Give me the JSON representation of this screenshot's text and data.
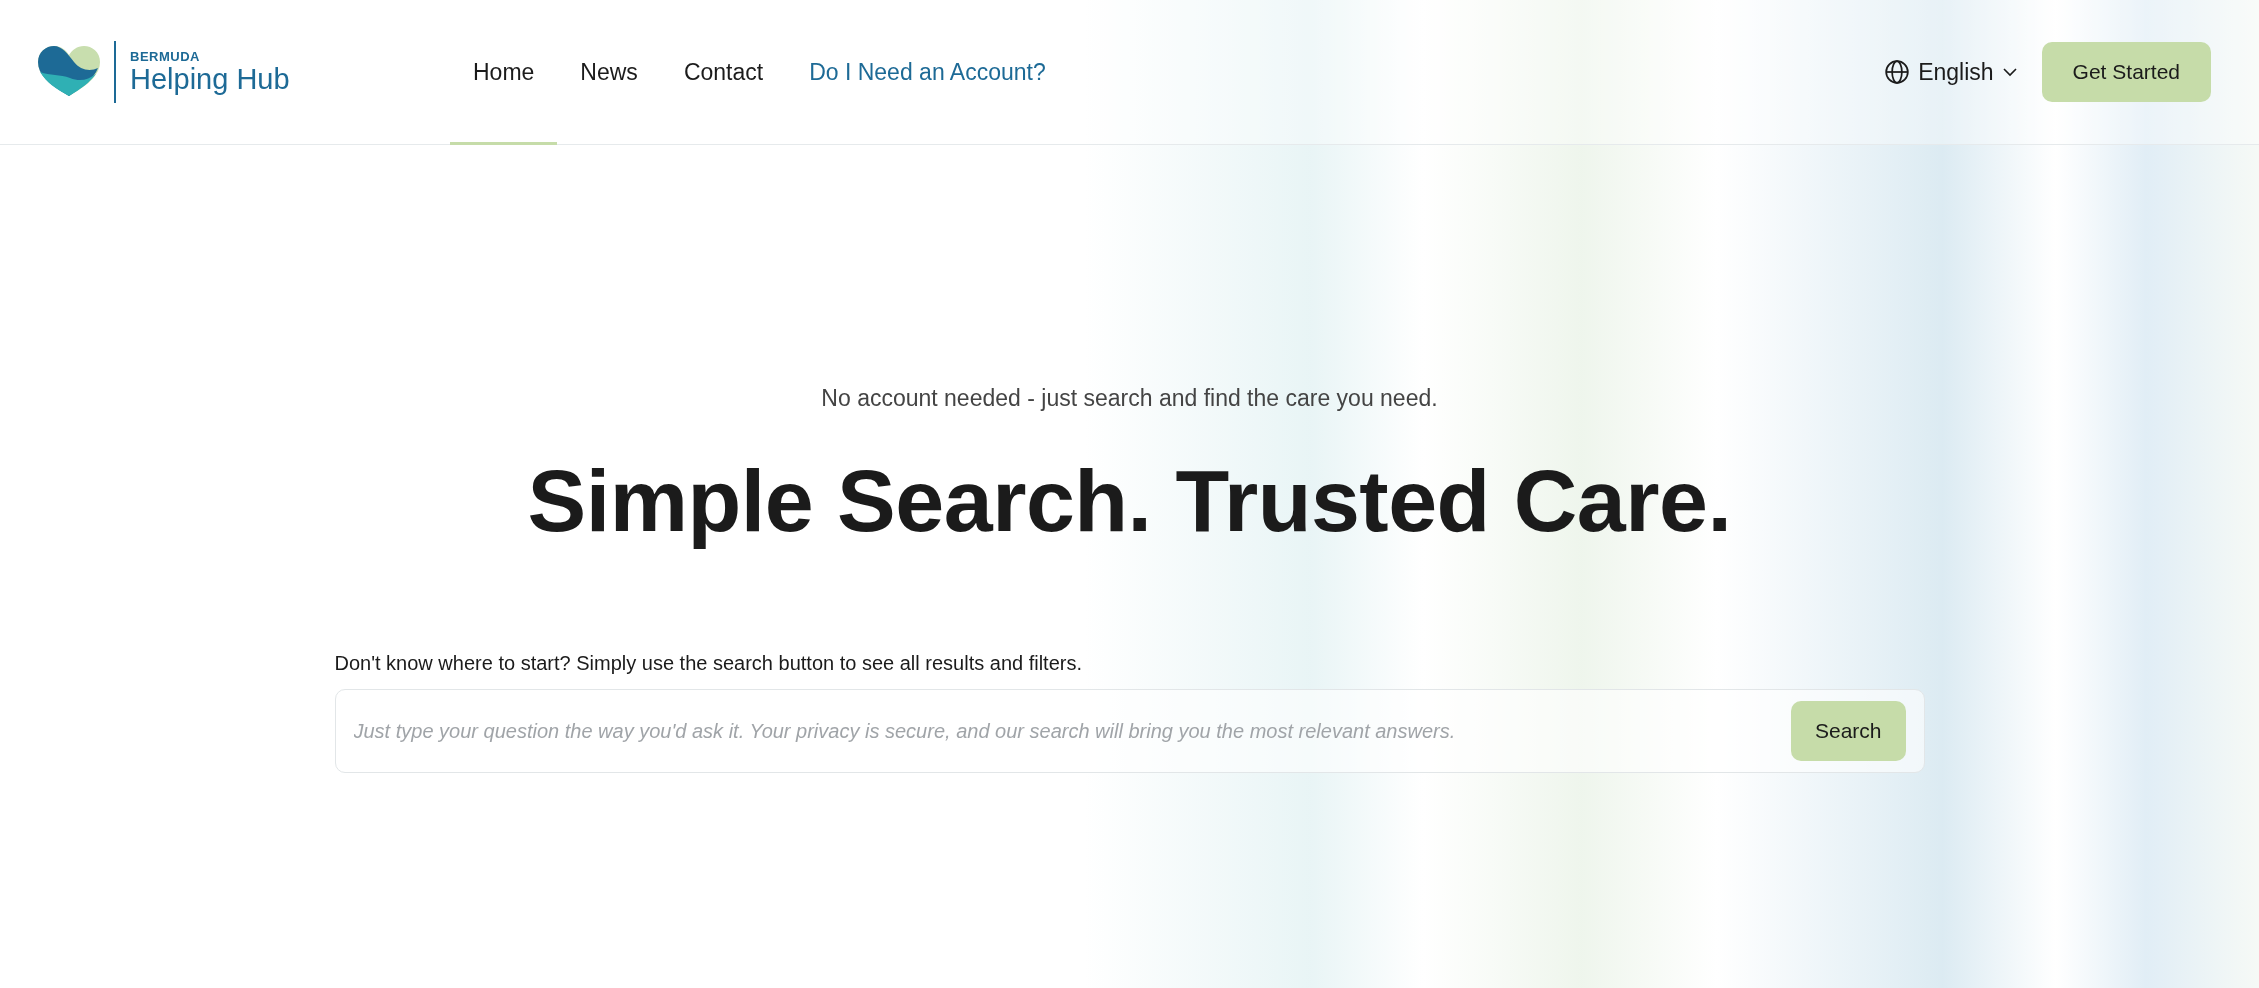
{
  "logo": {
    "overline": "BERMUDA",
    "name": "Helping Hub"
  },
  "nav": [
    {
      "label": "Home",
      "selected": true,
      "kind": "page"
    },
    {
      "label": "News",
      "selected": false,
      "kind": "page"
    },
    {
      "label": "Contact",
      "selected": false,
      "kind": "page"
    },
    {
      "label": "Do I Need an Account?",
      "selected": false,
      "kind": "link"
    }
  ],
  "language": {
    "label": "English"
  },
  "cta": "Get Started",
  "hero": {
    "tagline": "No account needed - just search and find the care you need.",
    "headline": "Simple Search. Trusted Care."
  },
  "search": {
    "hint": "Don't know where to start? Simply use the search button to see all results and filters.",
    "placeholder": "Just type your question the way you'd ask it. Your privacy is secure, and our search will bring you the most relevant answers.",
    "button": "Search"
  }
}
